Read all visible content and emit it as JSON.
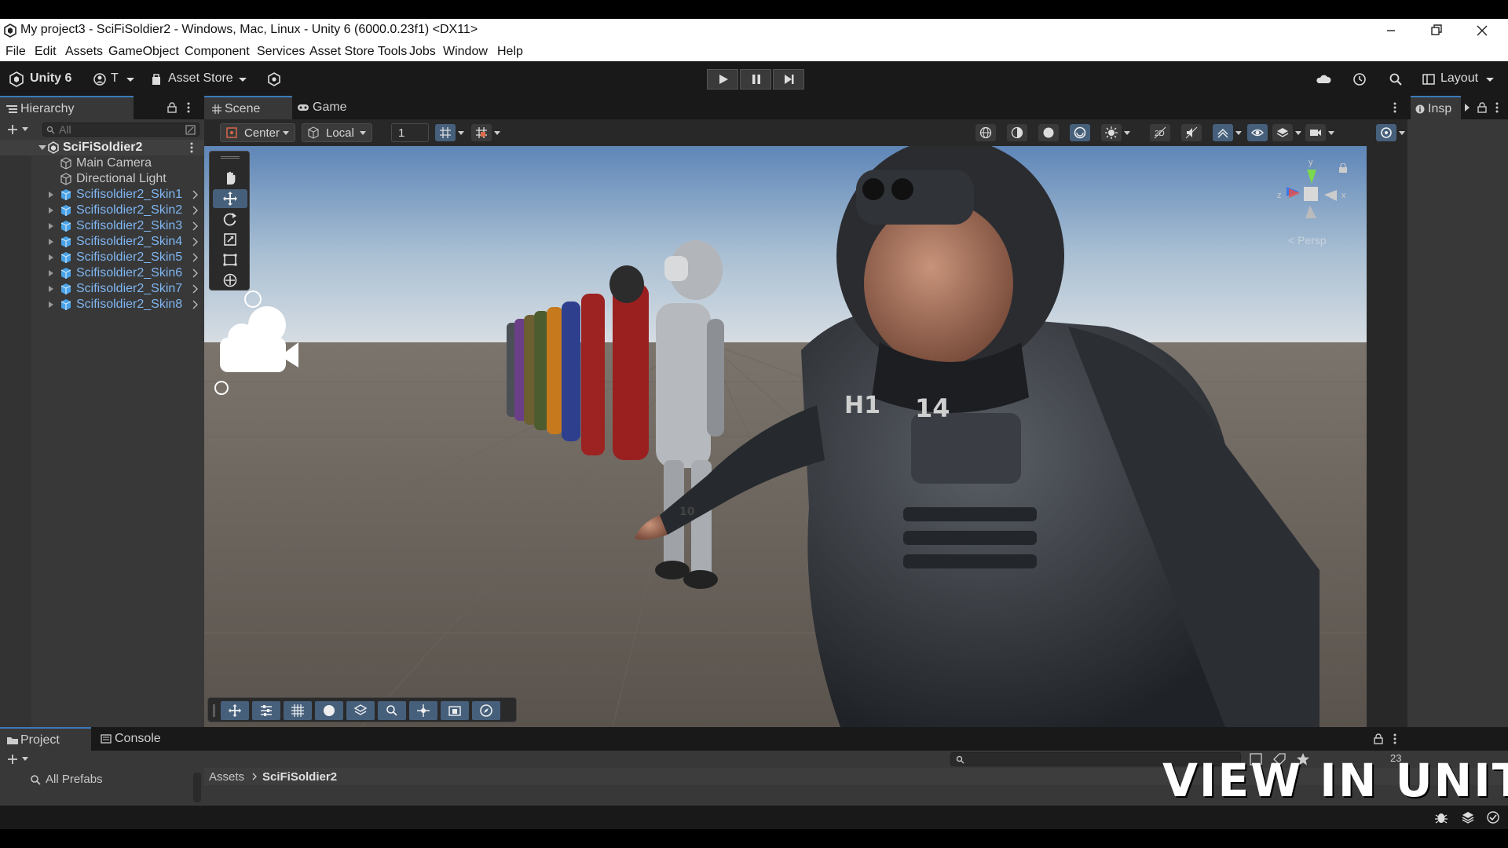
{
  "window": {
    "title": "My project3 - SciFiSoldier2 - Windows, Mac, Linux - Unity 6 (6000.0.23f1) <DX11>",
    "app_icon": "unity-logo-icon",
    "controls": [
      "minimize-icon",
      "restore-icon",
      "close-icon"
    ]
  },
  "menu": [
    "File",
    "Edit",
    "Assets",
    "GameObject",
    "Component",
    "Services",
    "Asset Store Tools",
    "Jobs",
    "Window",
    "Help"
  ],
  "toolbar": {
    "unity_label": "Unity 6",
    "account_label": "T",
    "asset_store_label": "Asset Store",
    "layout_label": "Layout",
    "play_icons": [
      "play-icon",
      "pause-icon",
      "step-icon"
    ],
    "right_icons": [
      "cloud-icon",
      "history-icon",
      "search-icon"
    ]
  },
  "hierarchy": {
    "tab_label": "Hierarchy",
    "search_placeholder": "All",
    "scene_root": "SciFiSoldier2",
    "items": [
      {
        "label": "Main Camera",
        "type": "gameobject"
      },
      {
        "label": "Directional Light",
        "type": "gameobject"
      },
      {
        "label": "Scifisoldier2_Skin1",
        "type": "prefab"
      },
      {
        "label": "Scifisoldier2_Skin2",
        "type": "prefab"
      },
      {
        "label": "Scifisoldier2_Skin3",
        "type": "prefab"
      },
      {
        "label": "Scifisoldier2_Skin4",
        "type": "prefab"
      },
      {
        "label": "Scifisoldier2_Skin5",
        "type": "prefab"
      },
      {
        "label": "Scifisoldier2_Skin6",
        "type": "prefab"
      },
      {
        "label": "Scifisoldier2_Skin7",
        "type": "prefab"
      },
      {
        "label": "Scifisoldier2_Skin8",
        "type": "prefab"
      }
    ]
  },
  "scene": {
    "tabs": [
      "Scene",
      "Game"
    ],
    "pivot_label": "Center",
    "space_label": "Local",
    "grid_value": "1",
    "gizmo": {
      "x": "x",
      "y": "y",
      "z": "z",
      "projection": "< Persp"
    },
    "soldier_marks": [
      "H1",
      "14",
      "10"
    ]
  },
  "inspector": {
    "tab_label": "Insp"
  },
  "project": {
    "tabs": [
      "Project",
      "Console"
    ],
    "filter_label": "All Prefabs",
    "breadcrumb": [
      "Assets",
      "SciFiSoldier2"
    ],
    "count": "23"
  },
  "watermark": "VIEW IN UNITY",
  "colors": {
    "accent": "#3a79bb",
    "prefab_text": "#7fb6f2",
    "sky_top": "#5b82b4",
    "ground": "#615a53"
  }
}
